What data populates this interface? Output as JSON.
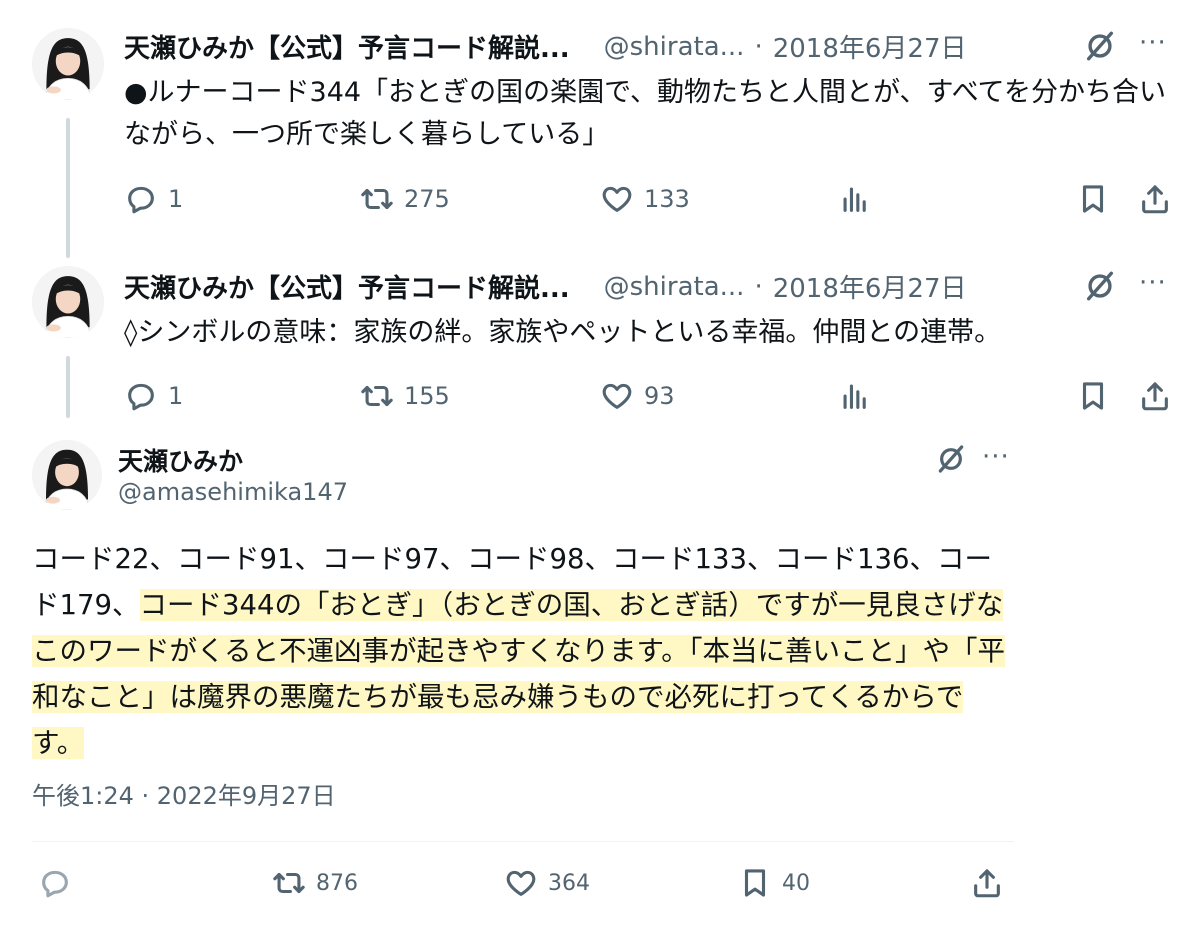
{
  "tweets": [
    {
      "name": "天瀬ひみか【公式】予言コード解説...",
      "handle": "@shirata...",
      "separator": "·",
      "date": "2018年6月27日",
      "text": "●ルナーコード344「おとぎの国の楽園で、動物たちと人間とが、すべてを分かち合いながら、一つ所で楽しく暮らしている」",
      "replies": "1",
      "retweets": "275",
      "likes": "133"
    },
    {
      "name": "天瀬ひみか【公式】予言コード解説...",
      "handle": "@shirata...",
      "separator": "·",
      "date": "2018年6月27日",
      "text": "◊シンボルの意味：家族の絆。家族やペットといる幸福。仲間との連帯。",
      "replies": "1",
      "retweets": "155",
      "likes": "93"
    }
  ],
  "main_tweet": {
    "name": "天瀬ひみか",
    "handle": "@amasehimika147",
    "text_plain": "コード22、コード91、コード97、コード98、コード133、コード136、コード179、",
    "text_highlighted": "コード344の「おとぎ」（おとぎの国、おとぎ話）ですが一見良さげなこのワードがくると不運凶事が起きやすくなります。「本当に善いこと」や「平和なこと」は魔界の悪魔たちが最も忌み嫌うもので必死に打ってくるからです。",
    "timestamp": "午後1:24 · 2022年9月27日",
    "retweets": "876",
    "likes": "364",
    "bookmarks": "40"
  },
  "more_label": "···",
  "colors": {
    "text": "#0f1419",
    "secondary": "#536471",
    "thread_line": "#cfd9de",
    "highlight": "#fff8c4"
  },
  "icons": [
    "reply-icon",
    "retweet-icon",
    "like-icon",
    "views-icon",
    "bookmark-icon",
    "share-icon",
    "grok-icon",
    "more-icon"
  ]
}
